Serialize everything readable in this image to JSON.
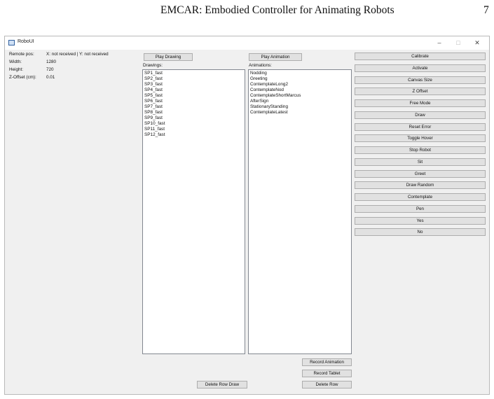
{
  "paper_header": {
    "title": "EMCAR: Embodied Controller for Animating Robots",
    "page_number": "7"
  },
  "window": {
    "title": "RoboUI",
    "icon": "app-window-icon",
    "controls": {
      "minimize": "–",
      "maximize": "□",
      "close": "✕"
    }
  },
  "info": {
    "remote_pos_label": "Remote pos:",
    "remote_pos_value": "X: not received | Y: not received",
    "width_label": "Width:",
    "width_value": "1280",
    "height_label": "Height:",
    "height_value": "720",
    "zoffset_label": "Z-Offset (cm):",
    "zoffset_value": "0.01"
  },
  "drawings": {
    "play_button": "Play Drawing",
    "label": "Drawings:",
    "items": [
      "SP1_fast",
      "SP2_fast",
      "SP3_fast",
      "SP4_fast",
      "SP5_fast",
      "SP6_fast",
      "SP7_fast",
      "SP8_fast",
      "SP9_fast",
      "SP10_fast",
      "SP11_fast",
      "SP12_fast"
    ],
    "delete_button": "Delete Row Draw"
  },
  "animations": {
    "play_button": "Play Animation",
    "label": "Animations:",
    "items": [
      "Nodding",
      "Greeting",
      "ContemplateLong2",
      "ContemplateNod",
      "ContemplateShortMarcus",
      "AfterSign",
      "StationaryStanding",
      "ContemplateLatest"
    ],
    "record_animation_button": "Record Animation",
    "record_tablet_button": "Record Tablet",
    "delete_button": "Delete Row"
  },
  "controls": {
    "buttons": [
      "Calibrate",
      "Activate",
      "Canvas Size",
      "Z Offset",
      "Free Mode",
      "Draw",
      "Reset Error",
      "Toggle Hover",
      "Stop Robot",
      "Sit",
      "Greet",
      "Draw Random",
      "Contemplate",
      "Pen",
      "Yes",
      "No"
    ]
  }
}
